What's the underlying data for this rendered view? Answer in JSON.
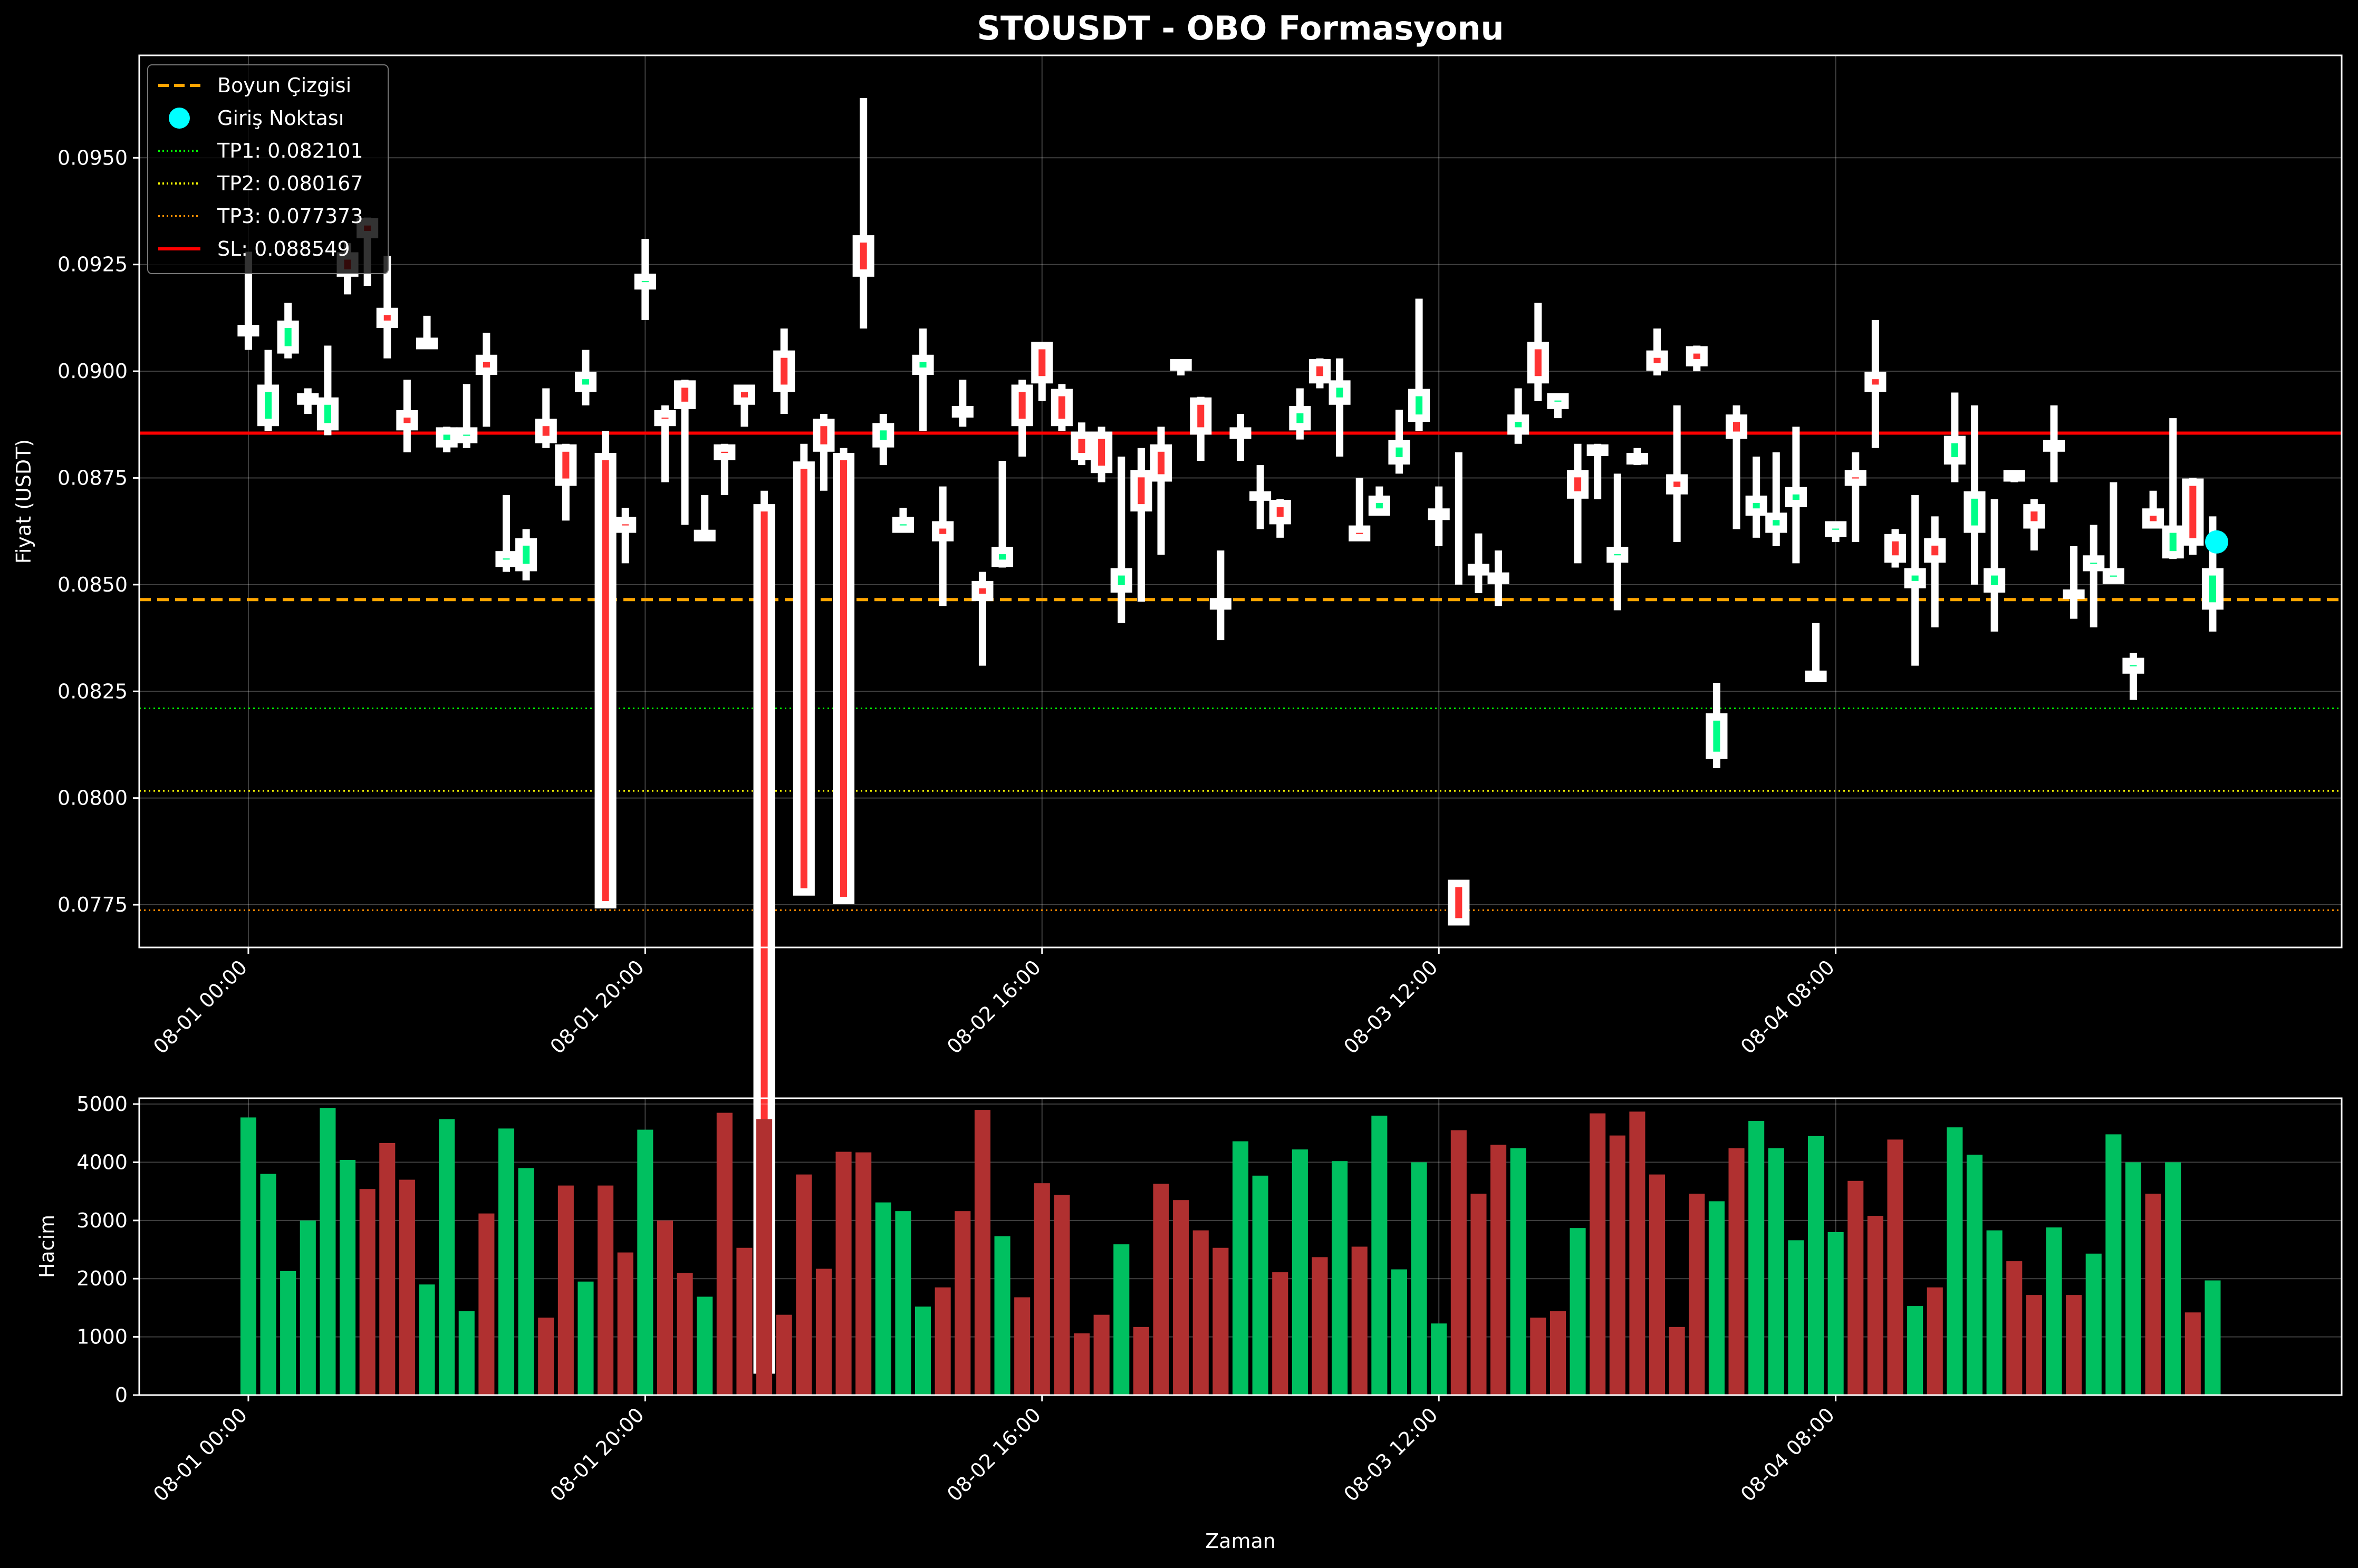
{
  "chart_data": [
    {
      "type": "candlestick",
      "title": "STOUSDT - OBO Formasyonu",
      "ylabel": "Fiyat (USDT)",
      "ylim": [
        0.0765,
        0.0974
      ],
      "yticks": [
        0.0775,
        0.08,
        0.0825,
        0.085,
        0.0875,
        0.09,
        0.0925,
        0.095
      ],
      "yticklabels": [
        "0.0775",
        "0.0800",
        "0.0825",
        "0.0850",
        "0.0875",
        "0.0900",
        "0.0925",
        "0.0950"
      ],
      "xlim": [
        -5.5,
        105.5
      ],
      "xticks": [
        0,
        20,
        40,
        60,
        80
      ],
      "xticklabels": [
        "08-01 00:00",
        "08-01 20:00",
        "08-02 16:00",
        "08-03 12:00",
        "08-04 08:00"
      ],
      "grid": true,
      "legend": "top-left",
      "colors": {
        "up": "#00ff88",
        "down": "#ff3333",
        "outline": "#ffffff",
        "neck": "#ffa500",
        "sl": "#ff0000",
        "tp1": "#00ff00",
        "tp2": "#ffff00",
        "tp3": "#ff8c00",
        "entry": "#00ffff"
      },
      "levels": [
        {
          "name": "Boyun Çizgisi",
          "value": 0.08465,
          "style": "dashed",
          "color": "#ffa500"
        },
        {
          "name": "TP1: 0.082101",
          "value": 0.082101,
          "style": "dotted",
          "color": "#00ff00"
        },
        {
          "name": "TP2: 0.080167",
          "value": 0.080167,
          "style": "dotted",
          "color": "#ffff00"
        },
        {
          "name": "TP3: 0.077373",
          "value": 0.077373,
          "style": "dotted",
          "color": "#ff8c00"
        },
        {
          "name": "SL: 0.088549",
          "value": 0.088549,
          "style": "solid",
          "color": "#ff0000"
        }
      ],
      "entry": {
        "name": "Giriş Noktası",
        "x": 99.2,
        "y": 0.086,
        "color": "#00ffff"
      },
      "candles": [
        [
          0.091,
          0.0909,
          0.0928,
          0.0905
        ],
        [
          0.0888,
          0.0896,
          0.0905,
          0.0886
        ],
        [
          0.0905,
          0.0911,
          0.0916,
          0.0903
        ],
        [
          0.0893,
          0.0894,
          0.0896,
          0.089
        ],
        [
          0.0887,
          0.0893,
          0.0906,
          0.0885
        ],
        [
          0.0927,
          0.0923,
          0.093,
          0.0918
        ],
        [
          0.0935,
          0.0932,
          0.0936,
          0.092
        ],
        [
          0.0914,
          0.0911,
          0.0927,
          0.0903
        ],
        [
          0.089,
          0.0887,
          0.0898,
          0.0881
        ],
        [
          0.0906,
          0.0907,
          0.0913,
          0.0906
        ],
        [
          0.0883,
          0.0886,
          0.0887,
          0.0881
        ],
        [
          0.0884,
          0.0886,
          0.0897,
          0.0882
        ],
        [
          0.0903,
          0.09,
          0.0909,
          0.0887
        ],
        [
          0.0855,
          0.0857,
          0.0871,
          0.0853
        ],
        [
          0.0854,
          0.086,
          0.0863,
          0.0851
        ],
        [
          0.0888,
          0.0884,
          0.0896,
          0.0882
        ],
        [
          0.0882,
          0.0874,
          0.0883,
          0.0865
        ],
        [
          0.0896,
          0.0899,
          0.0905,
          0.0892
        ],
        [
          0.088,
          0.0775,
          0.0886,
          0.0868
        ],
        [
          0.0865,
          0.0863,
          0.0868,
          0.0855
        ],
        [
          0.092,
          0.0922,
          0.0931,
          0.0912
        ],
        [
          0.089,
          0.0888,
          0.0892,
          0.0874
        ],
        [
          0.0897,
          0.0892,
          0.0898,
          0.0864
        ],
        [
          0.0862,
          0.0861,
          0.0871,
          0.0861
        ],
        [
          0.0882,
          0.088,
          0.0883,
          0.0871
        ],
        [
          0.0896,
          0.0893,
          0.0896,
          0.0887
        ],
        [
          0.0868,
          0.0666,
          0.0872,
          0.0857
        ],
        [
          0.0904,
          0.0896,
          0.091,
          0.089
        ],
        [
          0.0878,
          0.0778,
          0.0883,
          0.0864
        ],
        [
          0.0888,
          0.0882,
          0.089,
          0.0872
        ],
        [
          0.088,
          0.0776,
          0.0882,
          0.087
        ],
        [
          0.0931,
          0.0923,
          0.0964,
          0.091
        ],
        [
          0.0883,
          0.0887,
          0.089,
          0.0878
        ],
        [
          0.0863,
          0.0865,
          0.0868,
          0.0863
        ],
        [
          0.09,
          0.0903,
          0.091,
          0.0886
        ],
        [
          0.0864,
          0.0861,
          0.0873,
          0.0845
        ],
        [
          0.089,
          0.0891,
          0.0898,
          0.0887
        ],
        [
          0.085,
          0.0847,
          0.0853,
          0.0831
        ],
        [
          0.0855,
          0.0858,
          0.0879,
          0.0854
        ],
        [
          0.0896,
          0.0888,
          0.0898,
          0.088
        ],
        [
          0.0906,
          0.0898,
          0.0906,
          0.0893
        ],
        [
          0.0895,
          0.0888,
          0.0897,
          0.0886
        ],
        [
          0.0885,
          0.088,
          0.0888,
          0.0878
        ],
        [
          0.0885,
          0.0877,
          0.0887,
          0.0874
        ],
        [
          0.0849,
          0.0853,
          0.088,
          0.0841
        ],
        [
          0.0876,
          0.0868,
          0.0882,
          0.0846
        ],
        [
          0.0882,
          0.0875,
          0.0887,
          0.0857
        ],
        [
          0.0902,
          0.0901,
          0.0902,
          0.0899
        ],
        [
          0.0893,
          0.0886,
          0.0894,
          0.0879
        ],
        [
          0.0846,
          0.0845,
          0.0858,
          0.0837
        ],
        [
          0.0886,
          0.0885,
          0.089,
          0.0879
        ],
        [
          0.0871,
          0.0871,
          0.0878,
          0.0863
        ],
        [
          0.0869,
          0.0865,
          0.087,
          0.0861
        ],
        [
          0.0887,
          0.0891,
          0.0896,
          0.0884
        ],
        [
          0.0902,
          0.0898,
          0.0903,
          0.0896
        ],
        [
          0.0893,
          0.0897,
          0.0903,
          0.088
        ],
        [
          0.0863,
          0.0861,
          0.0875,
          0.0861
        ],
        [
          0.0867,
          0.087,
          0.0873,
          0.0867
        ],
        [
          0.0879,
          0.0883,
          0.0891,
          0.0876
        ],
        [
          0.0889,
          0.0895,
          0.0917,
          0.0886
        ],
        [
          0.0866,
          0.0867,
          0.0873,
          0.0859
        ],
        [
          0.078,
          0.0771,
          0.0881,
          0.085
        ],
        [
          0.0853,
          0.0854,
          0.0862,
          0.0848
        ],
        [
          0.0852,
          0.0851,
          0.0858,
          0.0845
        ],
        [
          0.0886,
          0.0889,
          0.0896,
          0.0883
        ],
        [
          0.0906,
          0.0898,
          0.0916,
          0.0893
        ],
        [
          0.0892,
          0.0894,
          0.0894,
          0.0889
        ],
        [
          0.0876,
          0.0871,
          0.0883,
          0.0855
        ],
        [
          0.0881,
          0.0882,
          0.0883,
          0.087
        ],
        [
          0.0856,
          0.0858,
          0.0876,
          0.0844
        ],
        [
          0.0879,
          0.088,
          0.0882,
          0.0878
        ],
        [
          0.0904,
          0.0901,
          0.091,
          0.0899
        ],
        [
          0.0875,
          0.0872,
          0.0892,
          0.086
        ],
        [
          0.0905,
          0.0902,
          0.0906,
          0.09
        ],
        [
          0.081,
          0.0819,
          0.0827,
          0.0807
        ],
        [
          0.0889,
          0.0885,
          0.0892,
          0.0863
        ],
        [
          0.0867,
          0.087,
          0.088,
          0.0861
        ],
        [
          0.0863,
          0.0866,
          0.0881,
          0.0859
        ],
        [
          0.0869,
          0.0872,
          0.0887,
          0.0855
        ],
        [
          0.0829,
          0.0828,
          0.0841,
          0.0828
        ],
        [
          0.0862,
          0.0864,
          0.0864,
          0.086
        ],
        [
          0.0876,
          0.0874,
          0.0881,
          0.086
        ],
        [
          0.0899,
          0.0896,
          0.0912,
          0.0882
        ],
        [
          0.0861,
          0.0856,
          0.0863,
          0.0854
        ],
        [
          0.085,
          0.0853,
          0.0871,
          0.0831
        ],
        [
          0.086,
          0.0856,
          0.0866,
          0.084
        ],
        [
          0.0879,
          0.0884,
          0.0895,
          0.0874
        ],
        [
          0.0863,
          0.0871,
          0.0892,
          0.085
        ],
        [
          0.0849,
          0.0853,
          0.087,
          0.0839
        ],
        [
          0.0876,
          0.0875,
          0.0876,
          0.0874
        ],
        [
          0.0868,
          0.0864,
          0.087,
          0.0858
        ],
        [
          0.0882,
          0.0883,
          0.0892,
          0.0874
        ],
        [
          0.0848,
          0.0848,
          0.0859,
          0.0842
        ],
        [
          0.0854,
          0.0856,
          0.0864,
          0.084
        ],
        [
          0.0851,
          0.0853,
          0.0874,
          0.0851
        ],
        [
          0.083,
          0.0832,
          0.0834,
          0.0823
        ],
        [
          0.0867,
          0.0864,
          0.0872,
          0.0864
        ],
        [
          0.0857,
          0.0863,
          0.0889,
          0.0856
        ],
        [
          0.0874,
          0.086,
          0.0875,
          0.0857
        ],
        [
          0.0845,
          0.0853,
          0.0866,
          0.0839
        ]
      ]
    },
    {
      "type": "bar",
      "xlabel": "Zaman",
      "ylabel": "Hacim",
      "ylim": [
        0,
        5100
      ],
      "yticks": [
        0,
        1000,
        2000,
        3000,
        4000,
        5000
      ],
      "yticklabels": [
        "0",
        "1000",
        "2000",
        "3000",
        "4000",
        "5000"
      ],
      "xlim": [
        -5.5,
        105.5
      ],
      "xticks": [
        0,
        20,
        40,
        60,
        80
      ],
      "xticklabels": [
        "08-01 00:00",
        "08-01 20:00",
        "08-02 16:00",
        "08-03 12:00",
        "08-04 08:00"
      ],
      "grid": true,
      "colors": {
        "up": "#00c060",
        "down": "#b03030"
      },
      "values": [
        4770,
        3800,
        2130,
        3000,
        4930,
        4040,
        3540,
        4330,
        3700,
        1900,
        4740,
        1440,
        3120,
        4580,
        3900,
        1330,
        3600,
        1950,
        3600,
        2450,
        4560,
        3000,
        2100,
        1690,
        4850,
        2530,
        4740,
        1380,
        3790,
        2170,
        4180,
        4170,
        3310,
        3160,
        1520,
        1850,
        3160,
        4900,
        2730,
        1680,
        3640,
        3440,
        1060,
        1380,
        2590,
        1170,
        3630,
        3350,
        2830,
        2530,
        4360,
        3770,
        2110,
        4220,
        2370,
        4020,
        2550,
        4800,
        2160,
        4000,
        1230,
        4550,
        3460,
        4300,
        4240,
        1330,
        1440,
        2870,
        4840,
        4460,
        4870,
        3790,
        1170,
        3460,
        3330,
        4240,
        4710,
        4240,
        2660,
        4450,
        2800,
        3680,
        3080,
        4390,
        1530,
        1850,
        4600,
        4130,
        2830,
        2300,
        1720,
        2880,
        1720,
        2430,
        4480,
        4000,
        3460,
        4000,
        1420,
        1970
      ],
      "up": [
        1,
        1,
        1,
        1,
        1,
        1,
        0,
        0,
        0,
        1,
        1,
        1,
        0,
        1,
        1,
        0,
        0,
        1,
        0,
        0,
        1,
        0,
        0,
        1,
        0,
        0,
        0,
        0,
        0,
        0,
        0,
        0,
        1,
        1,
        1,
        0,
        0,
        0,
        1,
        0,
        0,
        0,
        0,
        0,
        1,
        0,
        0,
        0,
        0,
        0,
        1,
        1,
        0,
        1,
        0,
        1,
        0,
        1,
        1,
        1,
        1,
        0,
        0,
        0,
        1,
        0,
        0,
        1,
        0,
        0,
        0,
        0,
        0,
        0,
        1,
        0,
        1,
        1,
        1,
        1,
        1,
        0,
        0,
        0,
        1,
        0,
        1,
        1,
        1,
        0,
        0,
        1,
        0,
        1,
        1,
        1,
        0,
        1,
        0,
        1
      ]
    }
  ]
}
